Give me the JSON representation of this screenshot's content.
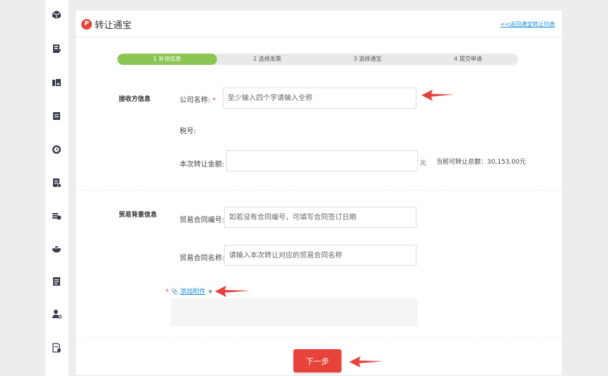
{
  "colors": {
    "accent_red": "#e8433b",
    "step_active": "#8cc652",
    "link_blue": "#1a8fd8",
    "arrow_red": "#e4433d"
  },
  "sidebar": {
    "icons": [
      "cube-icon",
      "document-check-icon",
      "image-icon",
      "clipboard-icon",
      "clock-icon",
      "report-icon",
      "coins-icon",
      "bowl-icon",
      "book-icon",
      "user-settings-icon",
      "file-settings-icon"
    ]
  },
  "header": {
    "logo_letter": "P",
    "title": "转让通宝",
    "back_link": "<<返回通宝转让列表"
  },
  "steps": [
    {
      "label": "1 补充信息",
      "active": true
    },
    {
      "label": "2 选择发票",
      "active": false
    },
    {
      "label": "3 选择通宝",
      "active": false
    },
    {
      "label": "4 提交申请",
      "active": false
    }
  ],
  "receiver_section": {
    "title": "接收方信息",
    "company_label": "公司名称:",
    "company_placeholder": "至少输入四个字请输入全称",
    "tax_label": "税号:",
    "amount_label": "本次转让金额:",
    "amount_value": "",
    "amount_unit": "元",
    "total_info": "当前可转让总额：30,153.00元"
  },
  "trade_section": {
    "title": "贸易背景信息",
    "contract_no_label": "贸易合同编号:",
    "contract_no_placeholder": "如若没有合同编号，可填写合同签订日期",
    "contract_name_label": "贸易合同名称:",
    "contract_name_placeholder": "请输入本次转让对应的贸易合同名称",
    "required_mark": "*",
    "attach_label": "添加附件"
  },
  "footer": {
    "next_label": "下一步"
  }
}
